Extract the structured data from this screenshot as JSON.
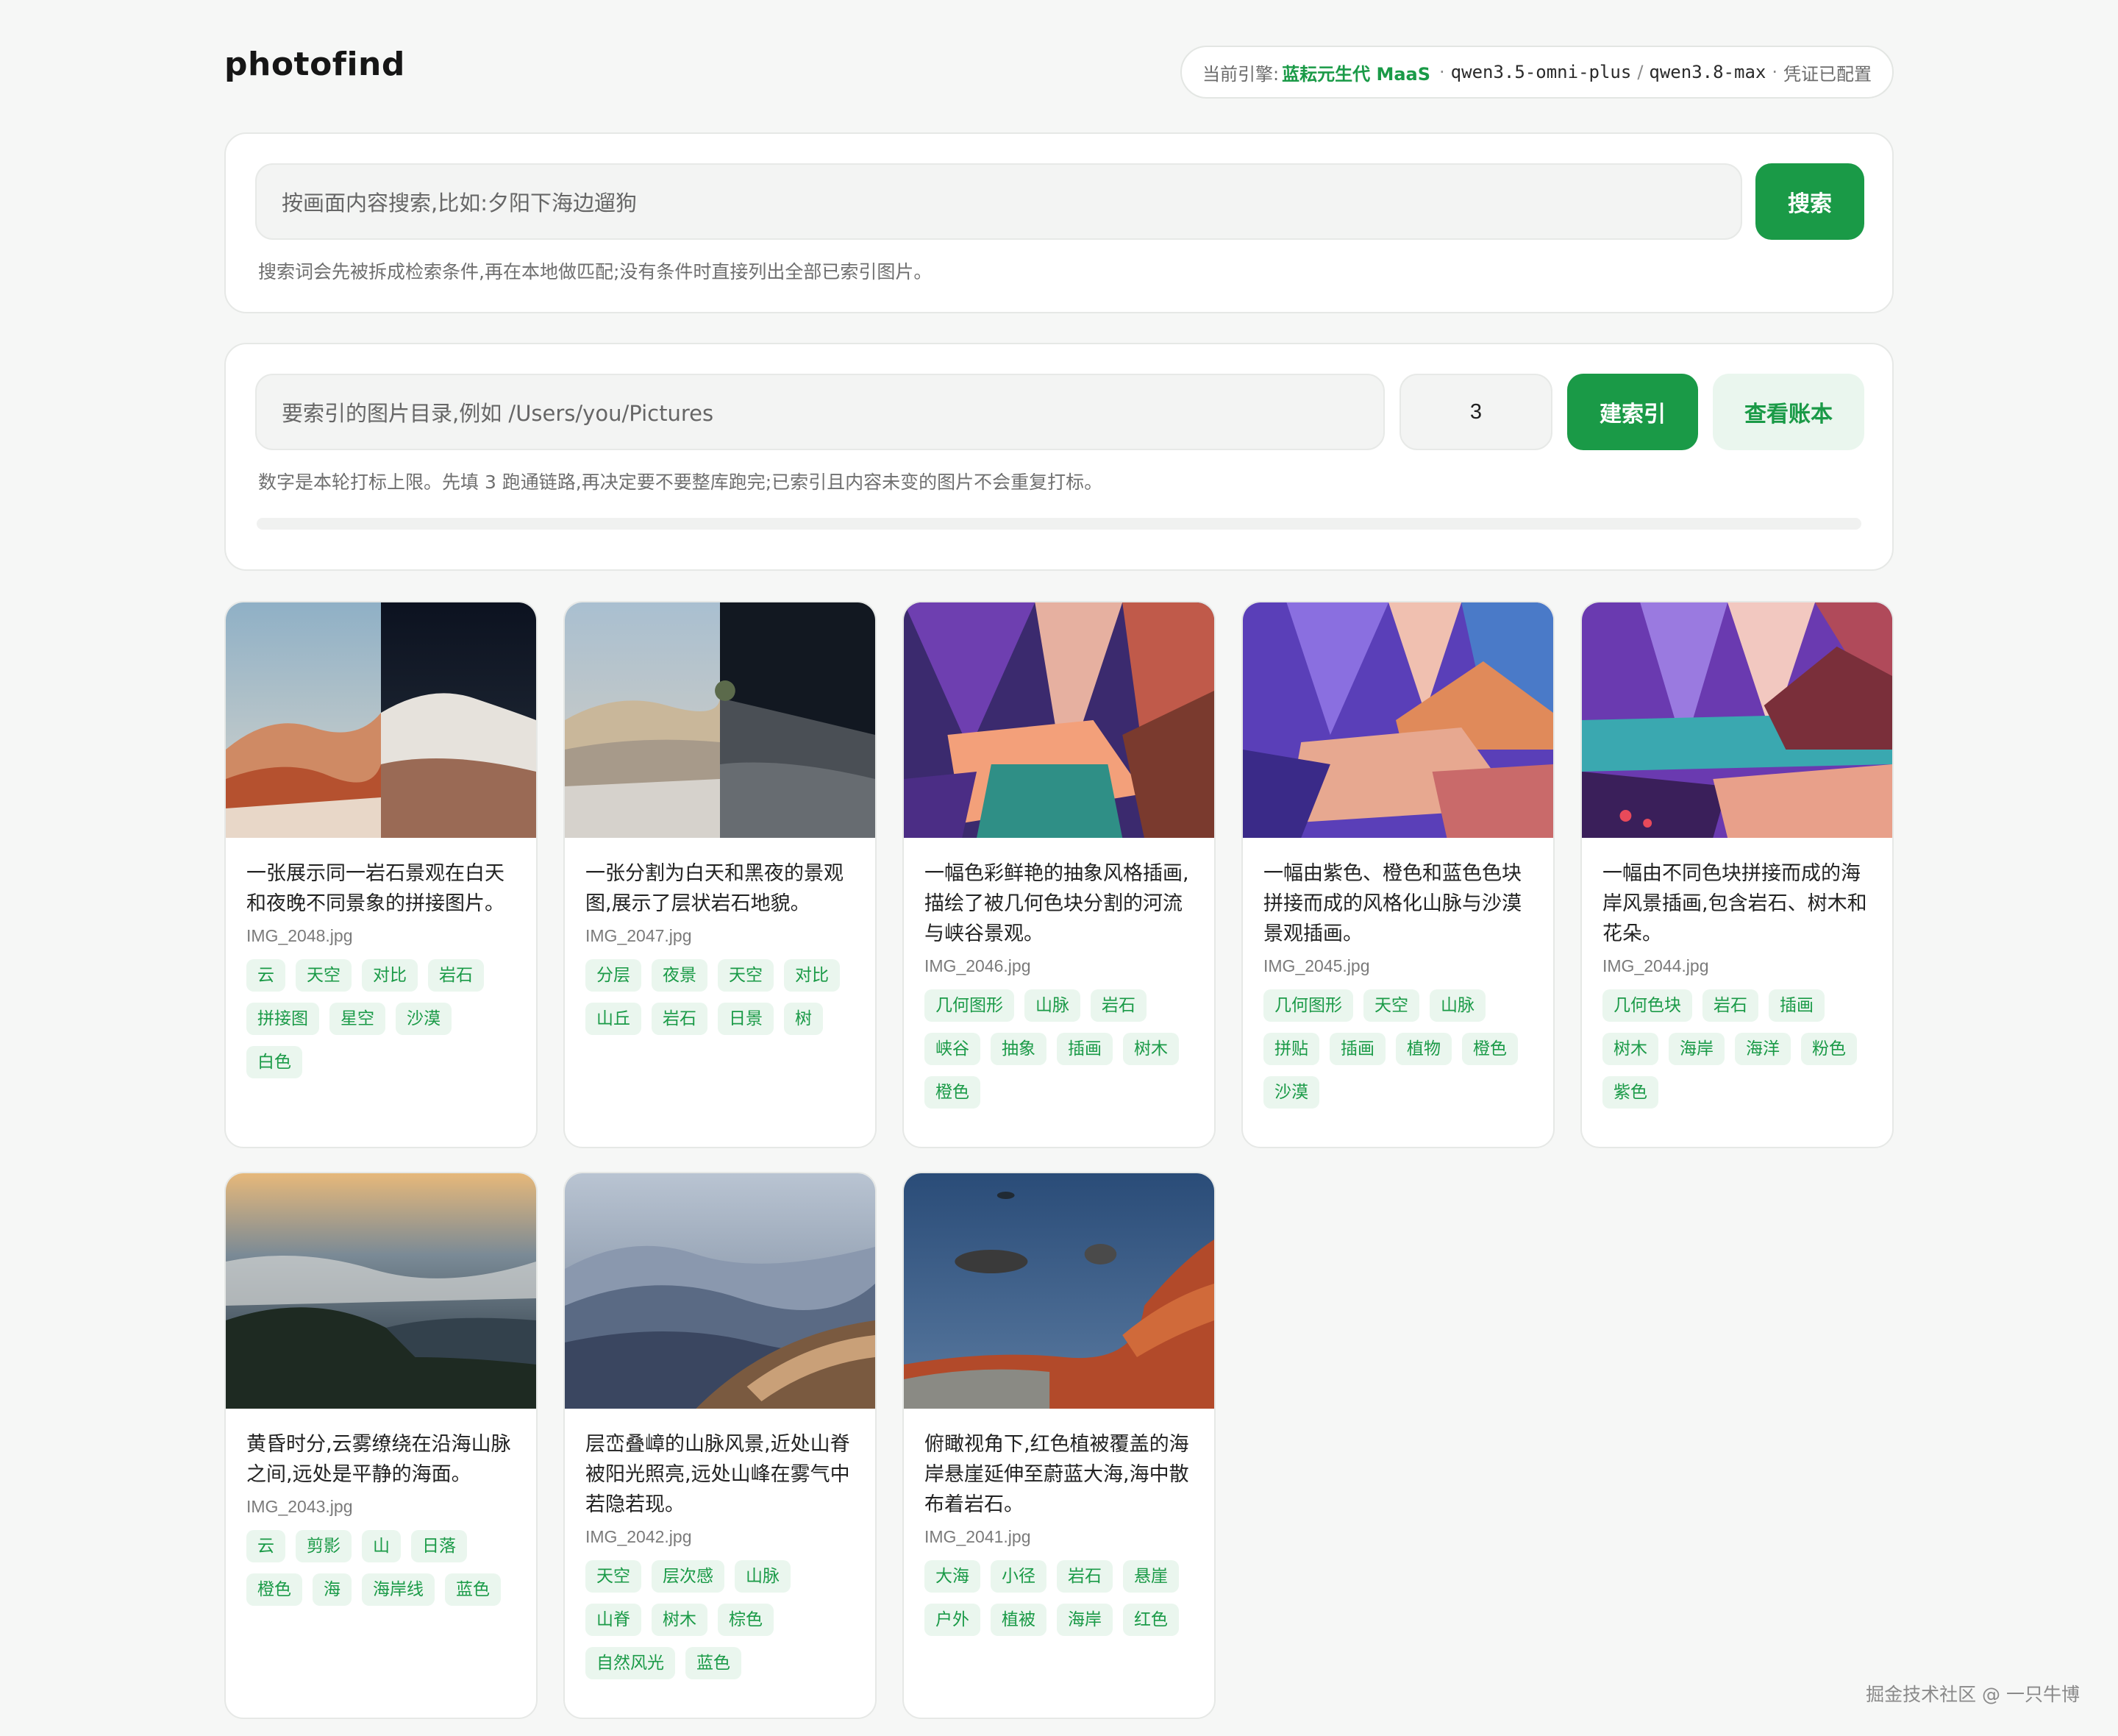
{
  "app": {
    "title": "photofind"
  },
  "engine": {
    "label": "当前引擎:",
    "brand": "蓝耘元生代 MaaS",
    "model1": "qwen3.5-omni-plus",
    "slash": "/",
    "model2": "qwen3.8-max",
    "status": "凭证已配置",
    "dot": "·",
    "brand_color": "#1a9a47"
  },
  "search": {
    "placeholder": "按画面内容搜索,比如:夕阳下海边遛狗",
    "button": "搜索",
    "hint": "搜索词会先被拆成检索条件,再在本地做匹配;没有条件时直接列出全部已索引图片。"
  },
  "index": {
    "dir_placeholder": "要索引的图片目录,例如 /Users/you/Pictures",
    "limit_value": "3",
    "build_button": "建索引",
    "ledger_button": "查看账本",
    "hint": "数字是本轮打标上限。先填 3 跑通链路,再决定要不要整库跑完;已索引且内容未变的图片不会重复打标。",
    "progress": 0
  },
  "results": [
    {
      "desc": "一张展示同一岩石景观在白天和夜晚不同景象的拼接图片。",
      "file": "IMG_2048.jpg",
      "tags": [
        "云",
        "天空",
        "对比",
        "岩石",
        "拼接图",
        "星空",
        "沙漠",
        "白色"
      ]
    },
    {
      "desc": "一张分割为白天和黑夜的景观图,展示了层状岩石地貌。",
      "file": "IMG_2047.jpg",
      "tags": [
        "分层",
        "夜景",
        "天空",
        "对比",
        "山丘",
        "岩石",
        "日景",
        "树"
      ]
    },
    {
      "desc": "一幅色彩鲜艳的抽象风格插画,描绘了被几何色块分割的河流与峡谷景观。",
      "file": "IMG_2046.jpg",
      "tags": [
        "几何图形",
        "山脉",
        "岩石",
        "峡谷",
        "抽象",
        "插画",
        "树木",
        "橙色"
      ]
    },
    {
      "desc": "一幅由紫色、橙色和蓝色色块拼接而成的风格化山脉与沙漠景观插画。",
      "file": "IMG_2045.jpg",
      "tags": [
        "几何图形",
        "天空",
        "山脉",
        "拼贴",
        "插画",
        "植物",
        "橙色",
        "沙漠"
      ]
    },
    {
      "desc": "一幅由不同色块拼接而成的海岸风景插画,包含岩石、树木和花朵。",
      "file": "IMG_2044.jpg",
      "tags": [
        "几何色块",
        "岩石",
        "插画",
        "树木",
        "海岸",
        "海洋",
        "粉色",
        "紫色"
      ]
    },
    {
      "desc": "黄昏时分,云雾缭绕在沿海山脉之间,远处是平静的海面。",
      "file": "IMG_2043.jpg",
      "tags": [
        "云",
        "剪影",
        "山",
        "日落",
        "橙色",
        "海",
        "海岸线",
        "蓝色"
      ]
    },
    {
      "desc": "层峦叠嶂的山脉风景,近处山脊被阳光照亮,远处山峰在雾气中若隐若现。",
      "file": "IMG_2042.jpg",
      "tags": [
        "天空",
        "层次感",
        "山脉",
        "山脊",
        "树木",
        "棕色",
        "自然风光",
        "蓝色"
      ]
    },
    {
      "desc": "俯瞰视角下,红色植被覆盖的海岸悬崖延伸至蔚蓝大海,海中散布着岩石。",
      "file": "IMG_2041.jpg",
      "tags": [
        "大海",
        "小径",
        "岩石",
        "悬崖",
        "户外",
        "植被",
        "海岸",
        "红色"
      ]
    }
  ],
  "watermark": "掘金技术社区 @ 一只牛博"
}
